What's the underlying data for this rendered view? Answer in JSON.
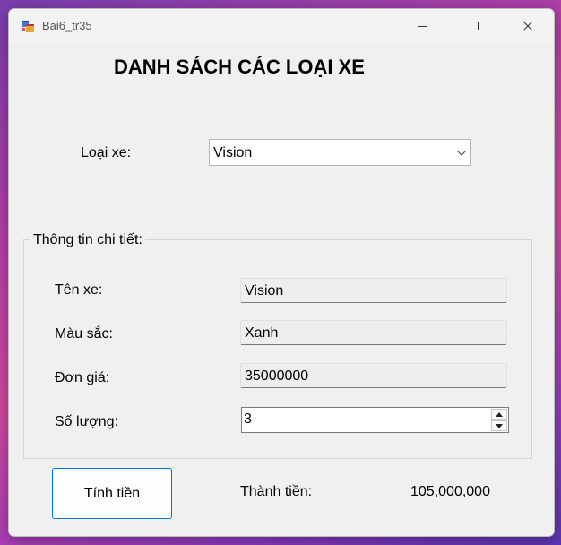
{
  "window": {
    "title": "Bai6_tr35",
    "icons": {
      "app": "winforms-app-icon",
      "minimize": "minimize-icon",
      "maximize": "maximize-icon",
      "close": "close-icon"
    }
  },
  "form": {
    "heading": "DANH SÁCH CÁC LOẠI XE",
    "vehicle_type_label": "Loại xe:",
    "vehicle_type_selected": "Vision",
    "details_group_title": "Thông tin chi tiết:",
    "name_label": "Tên xe:",
    "name_value": "Vision",
    "color_label": "Màu sắc:",
    "color_value": "Xanh",
    "price_label": "Đơn giá:",
    "price_value": "35000000",
    "quantity_label": "Số lượng:",
    "quantity_value": "3",
    "calc_button_label": "Tính tiền",
    "total_label": "Thành tiền:",
    "total_value": "105,000,000"
  },
  "colors": {
    "accent": "#0078d7",
    "window_bg": "#f0f0f0"
  }
}
